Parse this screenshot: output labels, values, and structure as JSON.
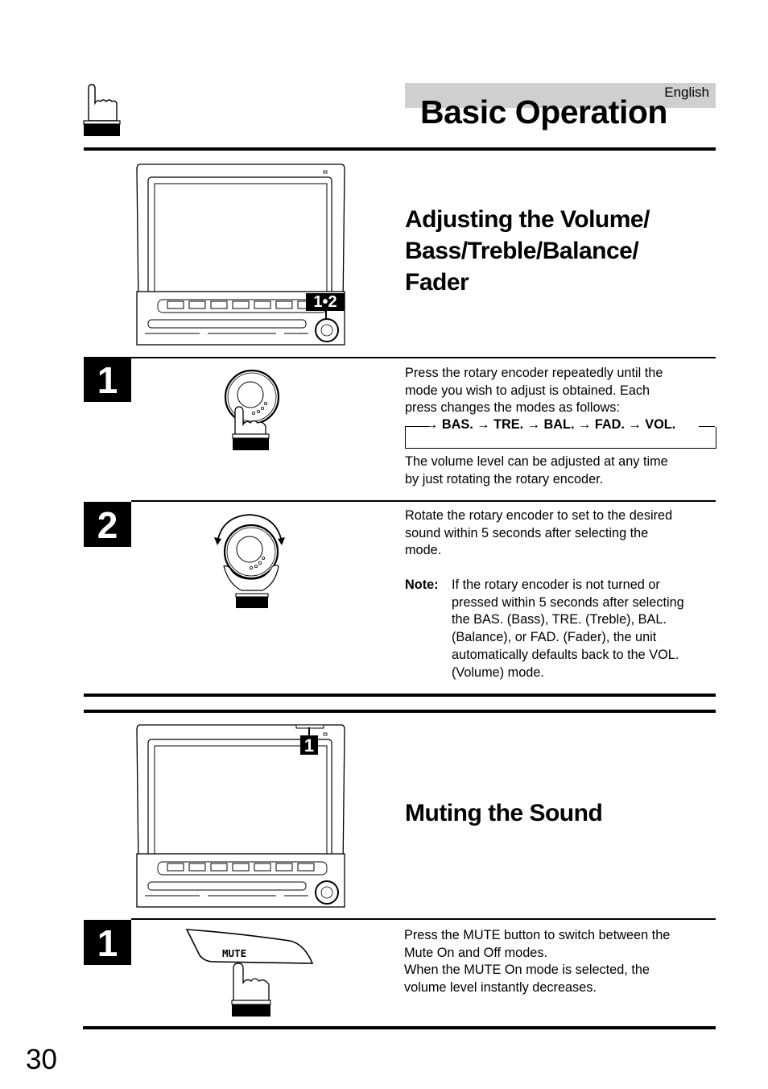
{
  "header": {
    "language": "English",
    "title": "Basic Operation",
    "icon": "pointing-hand-icon"
  },
  "section_volume": {
    "title_lines": [
      "Adjusting the Volume/",
      "Bass/Treble/Balance/",
      "Fader"
    ],
    "device_callout": "1•2",
    "steps": [
      {
        "number": "1",
        "icon": "hand-pressing-rotary-encoder-icon",
        "paragraph1": [
          "Press the rotary encoder repeatedly until the",
          "mode you wish to adjust is obtained. Each",
          "press changes the modes as follows:"
        ],
        "mode_cycle": [
          "BAS.",
          "TRE.",
          "BAL.",
          "FAD.",
          "VOL."
        ],
        "paragraph2": [
          "The volume level can be adjusted at any time",
          "by just rotating the rotary encoder."
        ]
      },
      {
        "number": "2",
        "icon": "hand-rotating-rotary-encoder-icon",
        "paragraph1": [
          "Rotate the rotary encoder to set to the desired",
          "sound within 5 seconds after selecting the",
          "mode."
        ],
        "note_label": "Note:",
        "note_lines": [
          "If the rotary encoder is not turned or",
          "pressed within 5 seconds after selecting",
          "the BAS. (Bass), TRE. (Treble), BAL.",
          "(Balance), or FAD. (Fader), the unit",
          "automatically defaults back to the VOL.",
          "(Volume) mode."
        ]
      }
    ]
  },
  "section_mute": {
    "title": "Muting the Sound",
    "device_callout": "1",
    "steps": [
      {
        "number": "1",
        "icon": "hand-pressing-mute-button-icon",
        "button_label": "MUTE",
        "lines": [
          "Press the MUTE button to switch between the",
          "Mute On and Off modes.",
          "When the MUTE On mode is selected, the",
          "volume level instantly decreases."
        ]
      }
    ]
  },
  "footer": {
    "page_number": "30"
  }
}
